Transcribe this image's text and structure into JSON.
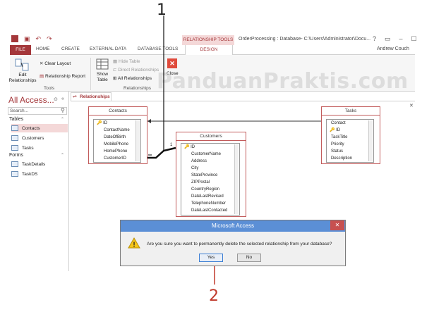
{
  "window": {
    "title": "OrderProcessing : Database- C:\\Users\\Administrator\\Docu...",
    "help": "?",
    "user": "Andrew Couch",
    "context_tab": "RELATIONSHIP TOOLS"
  },
  "tabs": [
    "FILE",
    "HOME",
    "CREATE",
    "EXTERNAL DATA",
    "DATABASE TOOLS",
    "DESIGN"
  ],
  "ribbon": {
    "edit_relationships": "Edit Relationships",
    "clear_layout": "Clear Layout",
    "relationship_report": "Relationship Report",
    "tools_group": "Tools",
    "show_table": "Show Table",
    "hide_table": "Hide Table",
    "direct_relationships": "Direct Relationships",
    "all_relationships": "All Relationships",
    "close": "Close",
    "relationships_group": "Relationships"
  },
  "watermark": "PanduanPraktis.com",
  "nav": {
    "title": "All Access...",
    "search_placeholder": "Search...",
    "tables_section": "Tables",
    "tables": [
      "Contacts",
      "Customers",
      "Tasks"
    ],
    "forms_section": "Forms",
    "forms": [
      "TaskDetails",
      "TaskDS"
    ]
  },
  "document_tab": "Relationships",
  "tables": {
    "contacts": {
      "title": "Contacts",
      "fields": [
        "ID",
        "ContactName",
        "DateOfBirth",
        "MobilePhone",
        "HomePhone",
        "CustomerID"
      ]
    },
    "customers": {
      "title": "Customers",
      "fields": [
        "ID",
        "CustomerName",
        "Address",
        "City",
        "StateProvince",
        "ZIPPostal",
        "CountryRegion",
        "DateLastRevised",
        "TelephoneNumber",
        "DateLastContacted"
      ]
    },
    "tasks": {
      "title": "Tasks",
      "fields": [
        "Contact",
        "ID",
        "TaskTitle",
        "Priority",
        "Status",
        "Description"
      ]
    }
  },
  "relationship": {
    "many": "∞",
    "one": "1"
  },
  "dialog": {
    "title": "Microsoft Access",
    "close": "✕",
    "message": "Are you sure you want to permanently delete the selected relationship from your database?",
    "yes": "Yes",
    "no": "No"
  },
  "callouts": {
    "one": "1",
    "two": "2"
  },
  "colors": {
    "accent": "#a4373a",
    "dialog_title": "#5b8fd6",
    "table_border": "#c25b5b"
  }
}
